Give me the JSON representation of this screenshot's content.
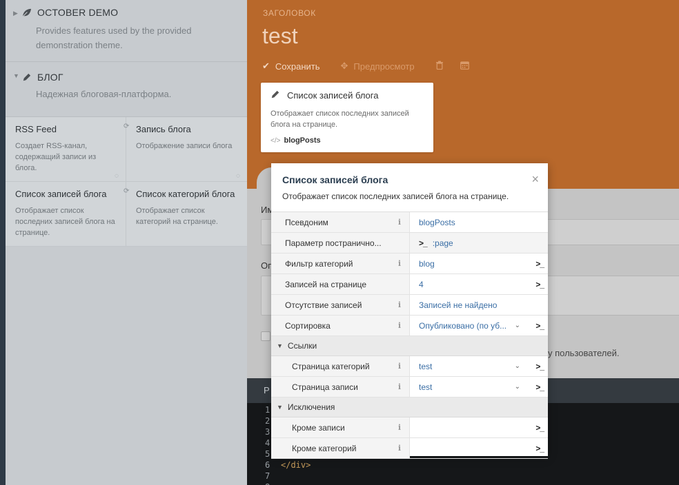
{
  "sidebar": {
    "plugins": [
      {
        "name": "OCTOBER DEMO",
        "description": "Provides features used by the provided demonstration theme.",
        "icon": "leaf-icon"
      },
      {
        "name": "БЛОГ",
        "description": "Надежная блоговая-платформа.",
        "icon": "pencil-icon"
      }
    ],
    "components": [
      {
        "title": "RSS Feed",
        "description": "Создает RSS-канал, содержащий записи из блога."
      },
      {
        "title": "Запись блога",
        "description": "Отображение записи блога"
      },
      {
        "title": "Список записей блога",
        "description": "Отображает список последних записей блога на странице."
      },
      {
        "title": "Список категорий блога",
        "description": "Отображает список категорий на странице."
      }
    ]
  },
  "header": {
    "label": "ЗАГОЛОВОК",
    "title": "test",
    "save_label": "Сохранить",
    "preview_label": "Предпросмотр",
    "color": "#b8682b"
  },
  "component_card": {
    "title": "Список записей блога",
    "description": "Отображает список последних записей блога на странице.",
    "alias": "blogPosts"
  },
  "form": {
    "label_name": "Им",
    "label_desc": "Оп",
    "checkbox_text": "у пользователей."
  },
  "codebar": {
    "title": "Р"
  },
  "code": {
    "line_numbers": [
      "1",
      "2",
      "3",
      "4",
      "5",
      "6",
      "7",
      "8"
    ],
    "visible_line": "</div>",
    "partial_line": "{"
  },
  "popup": {
    "title": "Список записей блога",
    "description": "Отображает список последних записей блога на странице.",
    "close": "×",
    "rows": [
      {
        "key": "Псевдоним",
        "value": "blogPosts",
        "info": true
      },
      {
        "key": "Параметр постранично...",
        "value": ":page",
        "info": false
      },
      {
        "key": "Фильтр категорий",
        "value": "blog",
        "info": true
      },
      {
        "key": "Записей на странице",
        "value": "4",
        "info": false
      },
      {
        "key": "Отсутствие записей",
        "value": "Записей не найдено",
        "info": true
      },
      {
        "key": "Сортировка",
        "value": "Опубликовано (по уб...",
        "info": true
      }
    ],
    "group_links": "Ссылки",
    "link_rows": [
      {
        "key": "Страница категорий",
        "value": "test"
      },
      {
        "key": "Страница записи",
        "value": "test"
      }
    ],
    "group_exceptions": "Исключения",
    "exception_rows": [
      {
        "key": "Кроме записи",
        "value": ""
      },
      {
        "key": "Кроме категорий",
        "value": ""
      }
    ],
    "terminal_glyph": ">_",
    "info_glyph": "i"
  }
}
